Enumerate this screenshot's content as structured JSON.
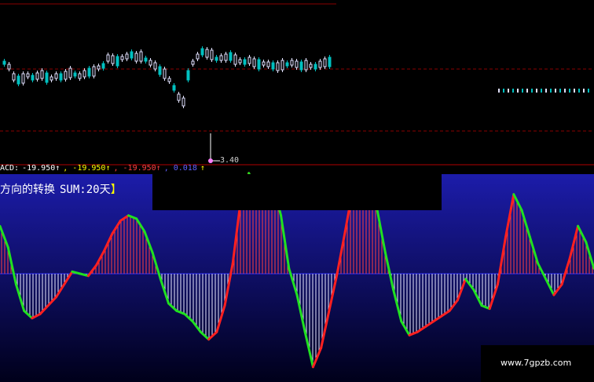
{
  "macd_readout": {
    "label": "ACD:",
    "values": [
      "-19.950↑",
      ", -19.950↑",
      ", -19.950↑",
      ", 0.018",
      "↑"
    ],
    "colors": [
      "#ffffff",
      "#ffff00",
      "#ff4040",
      "#6060ff",
      "#ffff00"
    ]
  },
  "indicator": {
    "title": "方向的转换",
    "sum_label": "SUM:20天",
    "bracket": "】"
  },
  "low_price_label": "3.40",
  "watermark": "www.7gpzb.com",
  "colors": {
    "background": "#000000",
    "panel_top": "#000000",
    "panel_gradient_top": "#1a1aa8",
    "panel_gradient_bottom": "#000018",
    "grid_red": "#a00000",
    "up_red": "#ff2020",
    "down_green": "#20e020",
    "candle_white": "#e0e0ff",
    "candle_cyan": "#00c0c0",
    "bar_white": "#ffffff"
  },
  "chart_data": {
    "type": "line",
    "price_low": 3.4,
    "indicator_series_note": "",
    "series": [
      {
        "values": [
          0.45,
          0.25,
          -0.1,
          -0.35,
          -0.42,
          -0.38,
          -0.3,
          -0.22,
          -0.1,
          0.02,
          0.0,
          -0.02,
          0.08,
          0.22,
          0.38,
          0.5,
          0.55,
          0.52,
          0.4,
          0.2,
          -0.05,
          -0.28,
          -0.35,
          -0.38,
          -0.45,
          -0.55,
          -0.62,
          -0.55,
          -0.3,
          0.1,
          0.7,
          0.95,
          0.8,
          0.78,
          0.85,
          0.55,
          0.05,
          -0.2,
          -0.55,
          -0.88,
          -0.7,
          -0.35,
          0.0,
          0.4,
          0.82,
          0.9,
          0.85,
          0.6,
          0.2,
          -0.15,
          -0.45,
          -0.58,
          -0.55,
          -0.5,
          -0.45,
          -0.4,
          -0.35,
          -0.25,
          -0.05,
          -0.15,
          -0.3,
          -0.33,
          -0.1,
          0.35,
          0.75,
          0.6,
          0.35,
          0.1,
          -0.05,
          -0.2,
          -0.1,
          0.15,
          0.45,
          0.3,
          0.05
        ]
      }
    ]
  }
}
